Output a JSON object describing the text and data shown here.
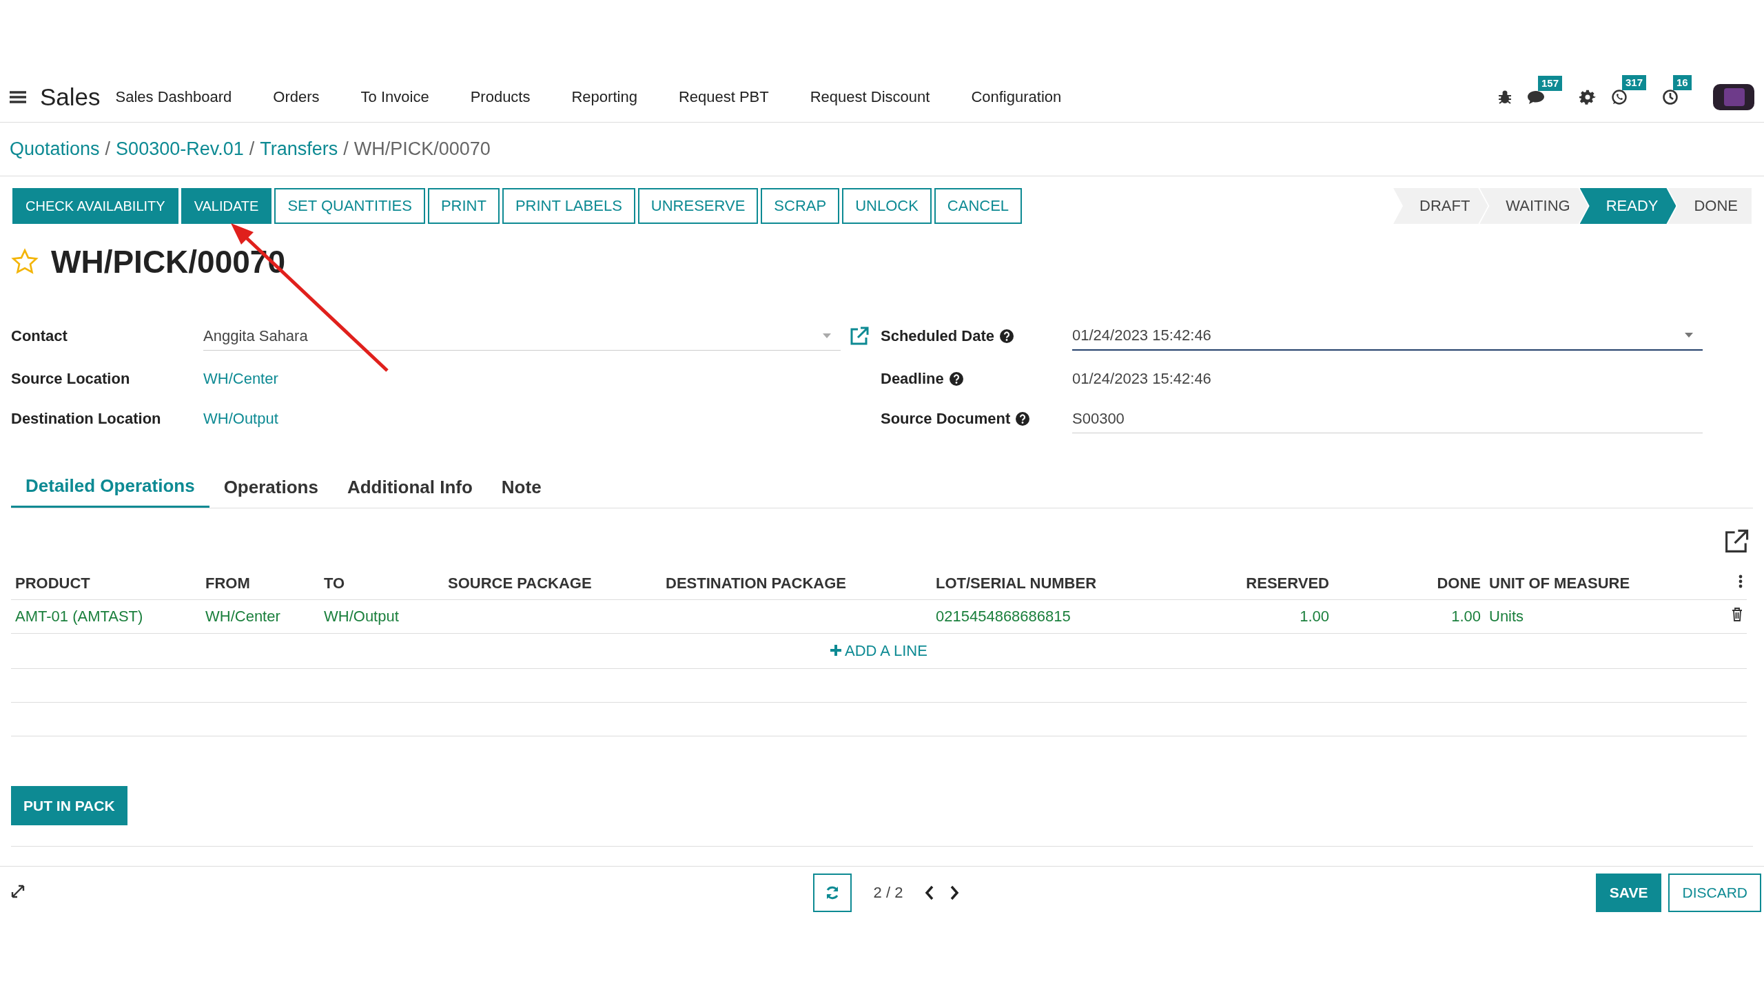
{
  "navbar": {
    "app": "Sales",
    "menu": [
      "Sales Dashboard",
      "Orders",
      "To Invoice",
      "Products",
      "Reporting",
      "Request PBT",
      "Request Discount",
      "Configuration"
    ],
    "systray": [
      {
        "kind": "bug"
      },
      {
        "kind": "chat",
        "count": "157"
      },
      {
        "kind": "gear"
      },
      {
        "kind": "phone",
        "count": "317"
      },
      {
        "kind": "clock",
        "count": "16"
      },
      {
        "kind": "avatar"
      }
    ]
  },
  "breadcrumb": {
    "separator": "/",
    "items": [
      {
        "label": "Quotations",
        "link": true
      },
      {
        "label": "S00300-Rev.01",
        "link": true
      },
      {
        "label": "Transfers",
        "link": true
      },
      {
        "label": "WH/PICK/00070",
        "link": false
      }
    ]
  },
  "actions": [
    {
      "label": "CHECK AVAILABILITY",
      "primary": true
    },
    {
      "label": "VALIDATE",
      "primary": true
    },
    {
      "label": "SET QUANTITIES",
      "primary": false
    },
    {
      "label": "PRINT",
      "primary": false
    },
    {
      "label": "PRINT LABELS",
      "primary": false
    },
    {
      "label": "UNRESERVE",
      "primary": false
    },
    {
      "label": "SCRAP",
      "primary": false
    },
    {
      "label": "UNLOCK",
      "primary": false
    },
    {
      "label": "CANCEL",
      "primary": false
    }
  ],
  "status": [
    {
      "label": "DRAFT",
      "selected": false
    },
    {
      "label": "WAITING",
      "selected": false
    },
    {
      "label": "READY",
      "selected": true
    },
    {
      "label": "DONE",
      "selected": false
    }
  ],
  "record": {
    "title": "WH/PICK/00070",
    "starred": false
  },
  "fields_left": [
    {
      "label": "Contact",
      "value": "Anggita Sahara",
      "kind": "many2one"
    },
    {
      "label": "Source Location",
      "value": "WH/Center",
      "kind": "link"
    },
    {
      "label": "Destination Location",
      "value": "WH/Output",
      "kind": "link"
    }
  ],
  "fields_right": [
    {
      "label": "Scheduled Date",
      "value": "01/24/2023 15:42:46",
      "kind": "datetime",
      "help": true
    },
    {
      "label": "Deadline",
      "value": "01/24/2023 15:42:46",
      "kind": "text",
      "help": true
    },
    {
      "label": "Source Document",
      "value": "S00300",
      "kind": "input",
      "help": true
    }
  ],
  "tabs": [
    {
      "label": "Detailed Operations",
      "selected": true
    },
    {
      "label": "Operations",
      "selected": false
    },
    {
      "label": "Additional Info",
      "selected": false
    },
    {
      "label": "Note",
      "selected": false
    }
  ],
  "table": {
    "columns": [
      {
        "label": "PRODUCT",
        "kind": "text"
      },
      {
        "label": "FROM",
        "kind": "text"
      },
      {
        "label": "TO",
        "kind": "text"
      },
      {
        "label": "SOURCE PACKAGE",
        "kind": "text"
      },
      {
        "label": "DESTINATION PACKAGE",
        "kind": "text"
      },
      {
        "label": "LOT/SERIAL NUMBER",
        "kind": "text"
      },
      {
        "label": "RESERVED",
        "kind": "number"
      },
      {
        "label": "DONE",
        "kind": "number"
      },
      {
        "label": "UNIT OF MEASURE",
        "kind": "text"
      }
    ],
    "rows": [
      {
        "cells": [
          "AMT-01 (AMTAST)",
          "WH/Center",
          "WH/Output",
          "",
          "",
          "0215454868686815",
          "1.00",
          "1.00",
          "Units"
        ]
      }
    ],
    "add_line": "ADD A LINE"
  },
  "pack_button": "PUT IN PACK",
  "pager": {
    "value": "2 / 2"
  },
  "form_buttons": [
    {
      "label": "SAVE",
      "primary": true
    },
    {
      "label": "DISCARD",
      "primary": false
    }
  ]
}
